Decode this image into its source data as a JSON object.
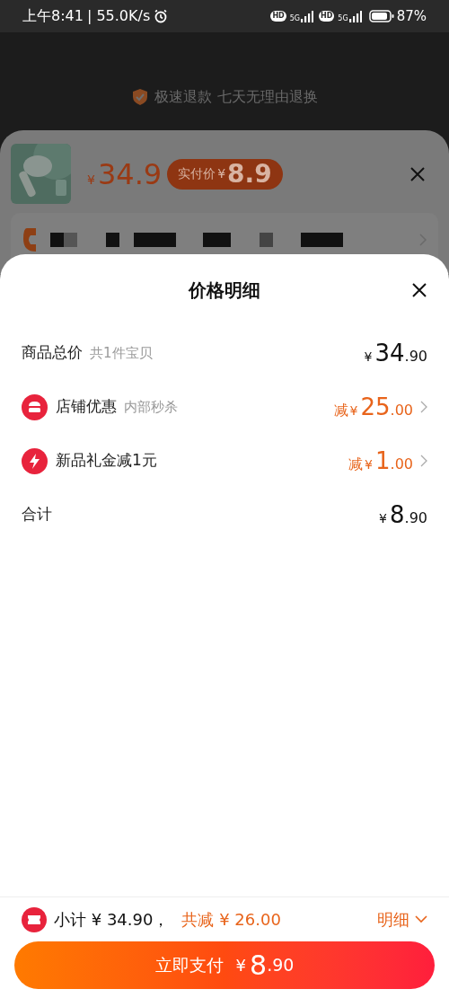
{
  "status_bar": {
    "time": "上午8:41",
    "speed": "| 55.0K/s",
    "sims": [
      {
        "hd_label": "HD",
        "network": "5G"
      },
      {
        "hd_label": "HD",
        "network": "5G"
      }
    ],
    "battery": "87%"
  },
  "background": {
    "guarantee": "极速退款 七天无理由退换",
    "product": {
      "price": {
        "currency": "¥",
        "integer": "34.9"
      },
      "pay_badge": {
        "label": "实付价",
        "currency": "¥",
        "integer": "8.9"
      }
    }
  },
  "sheet": {
    "title": "价格明细",
    "rows": [
      {
        "kind": "total",
        "label": "商品总价",
        "note": "共1件宝贝",
        "price": {
          "currency": "¥",
          "integer": "34",
          "decimal": ".90"
        }
      },
      {
        "kind": "discount",
        "label": "店铺优惠",
        "note": "内部秒杀",
        "prefix": "减",
        "price": {
          "currency": "¥",
          "integer": "25",
          "decimal": ".00"
        }
      },
      {
        "kind": "discount",
        "label": "新品礼金减1元",
        "prefix": "减",
        "price": {
          "currency": "¥",
          "integer": "1",
          "decimal": ".00"
        }
      },
      {
        "kind": "total",
        "label": "合计",
        "price": {
          "currency": "¥",
          "integer": "8",
          "decimal": ".90"
        }
      }
    ]
  },
  "footer": {
    "subtotal": "小计 ¥ 34.90，",
    "saved": "共减 ¥ 26.00",
    "details": "明细",
    "pay_button": {
      "label": "立即支付",
      "currency": "¥",
      "integer": "8",
      "decimal": ".90"
    }
  }
}
